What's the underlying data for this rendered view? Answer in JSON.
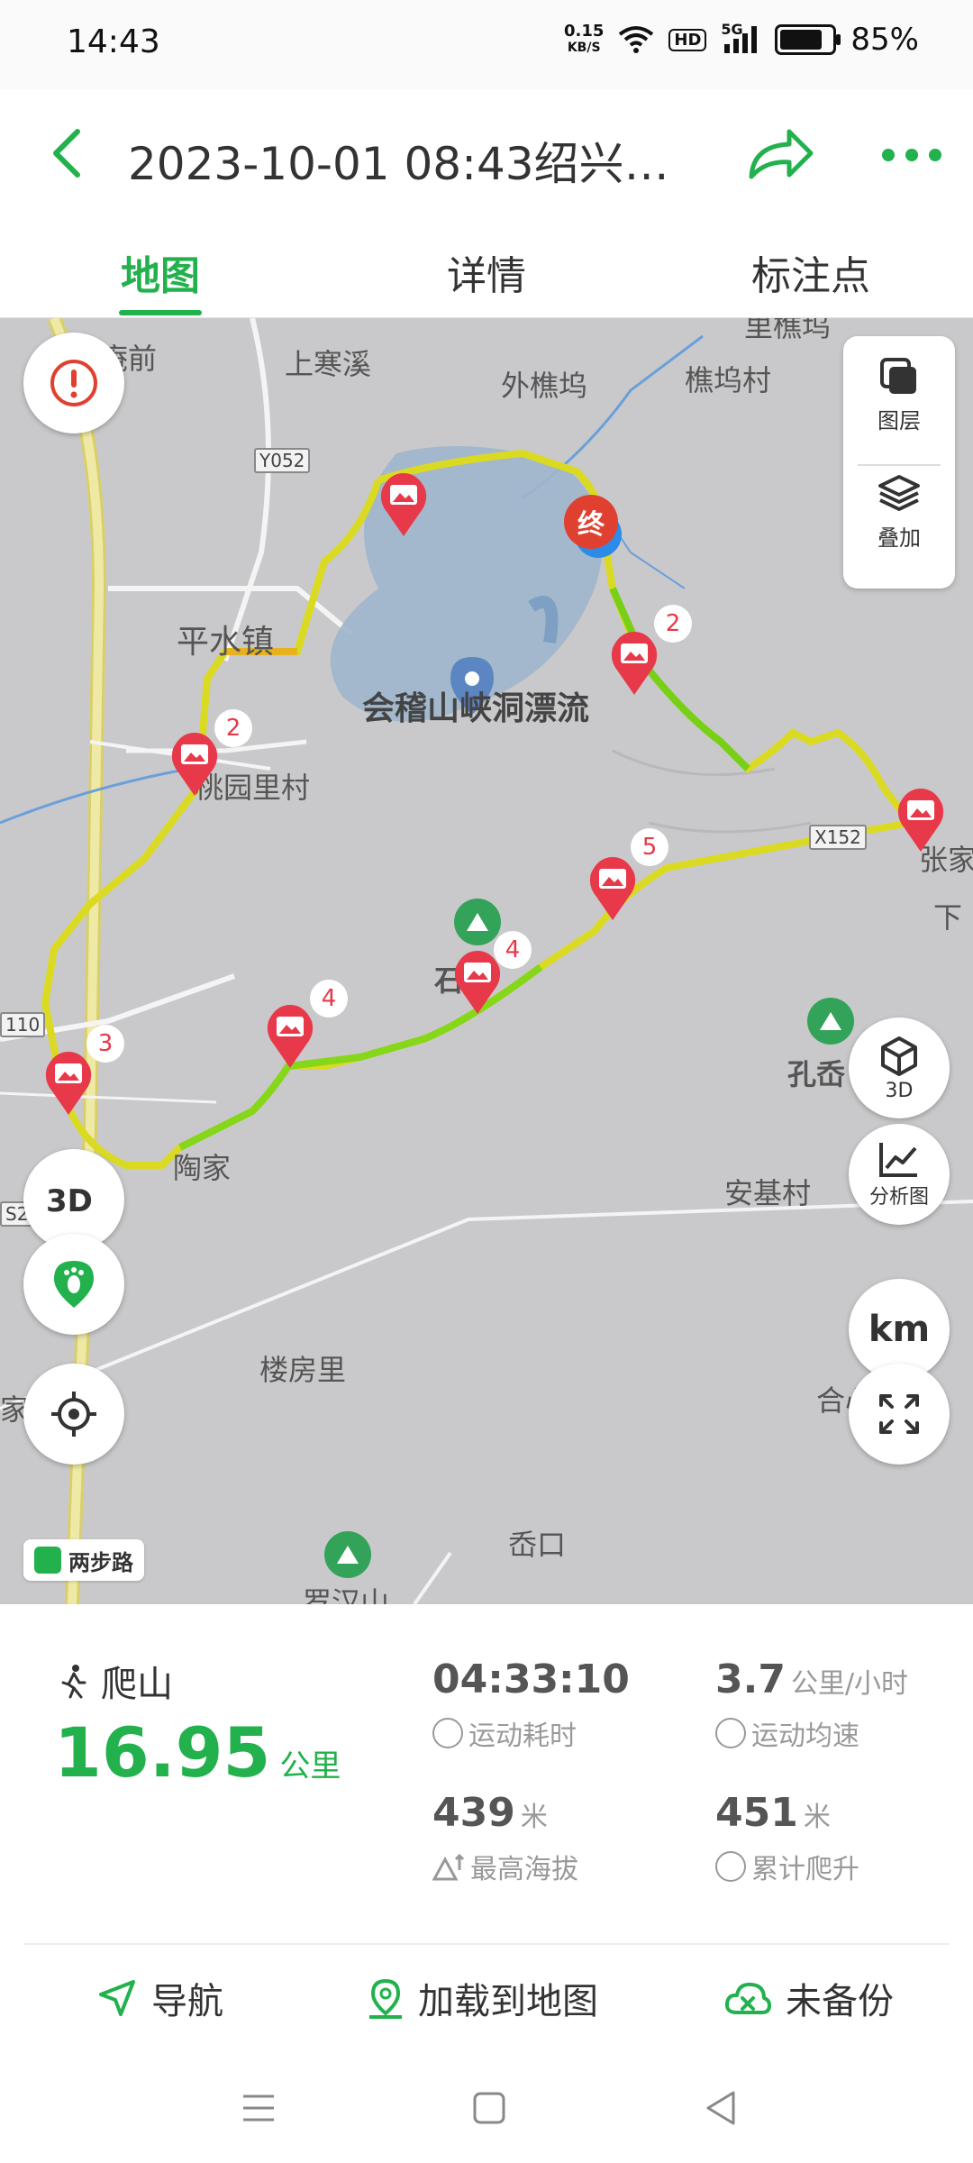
{
  "status_bar": {
    "time": "14:43",
    "net_speed_value": "0.15",
    "net_speed_unit": "KB/S",
    "hd": "HD",
    "signal": "5G",
    "battery": "85%"
  },
  "header": {
    "title": "2023-10-01 08:43绍兴柯..."
  },
  "tabs": [
    "地图",
    "详情",
    "标注点"
  ],
  "map": {
    "labels": {
      "anqian": "庵前",
      "shanghanxi": "上寒溪",
      "waiqiaowu": "外樵坞",
      "qiaowucun": "樵坞村",
      "liqiao": "里樵坞",
      "pingshuizhen": "平水镇",
      "lake": "会稽山峡洞漂流",
      "taoyuanli": "桃园里村",
      "zhangjia": "张家",
      "xia": "下",
      "shitou": "石头",
      "kongxi": "孔岙",
      "taojia": "陶家",
      "anjicun": "安基村",
      "loufangli": "楼房里",
      "hexincun": "合心村",
      "jialing": "家岭",
      "aokou": "岙口",
      "luohanshan": "罗汉山"
    },
    "road_tags": {
      "y052": "Y052",
      "x": "X152",
      "r110": "110",
      "s2": "S2"
    },
    "markers": [
      "2",
      "2",
      "3",
      "4",
      "4",
      "5"
    ],
    "end_marker": "终",
    "layer_panel": {
      "layers": "图层",
      "overlay": "叠加"
    },
    "right_buttons": {
      "three_d": "3D",
      "analysis": "分析图",
      "unit": "km"
    },
    "logo": "两步路"
  },
  "activity": {
    "type": "爬山",
    "distance": "16.95",
    "distance_unit": "公里",
    "stats": {
      "duration": {
        "value": "04:33:10",
        "unit": "",
        "label": "运动耗时"
      },
      "speed": {
        "value": "3.7",
        "unit": "公里/小时",
        "label": "运动均速"
      },
      "max_alt": {
        "value": "439",
        "unit": "米",
        "label": "最高海拔"
      },
      "climb": {
        "value": "451",
        "unit": "米",
        "label": "累计爬升"
      }
    }
  },
  "actions": {
    "navigate": "导航",
    "load": "加载到地图",
    "backup": "未备份"
  },
  "colors": {
    "accent": "#22b14c",
    "marker": "#e8394a"
  }
}
